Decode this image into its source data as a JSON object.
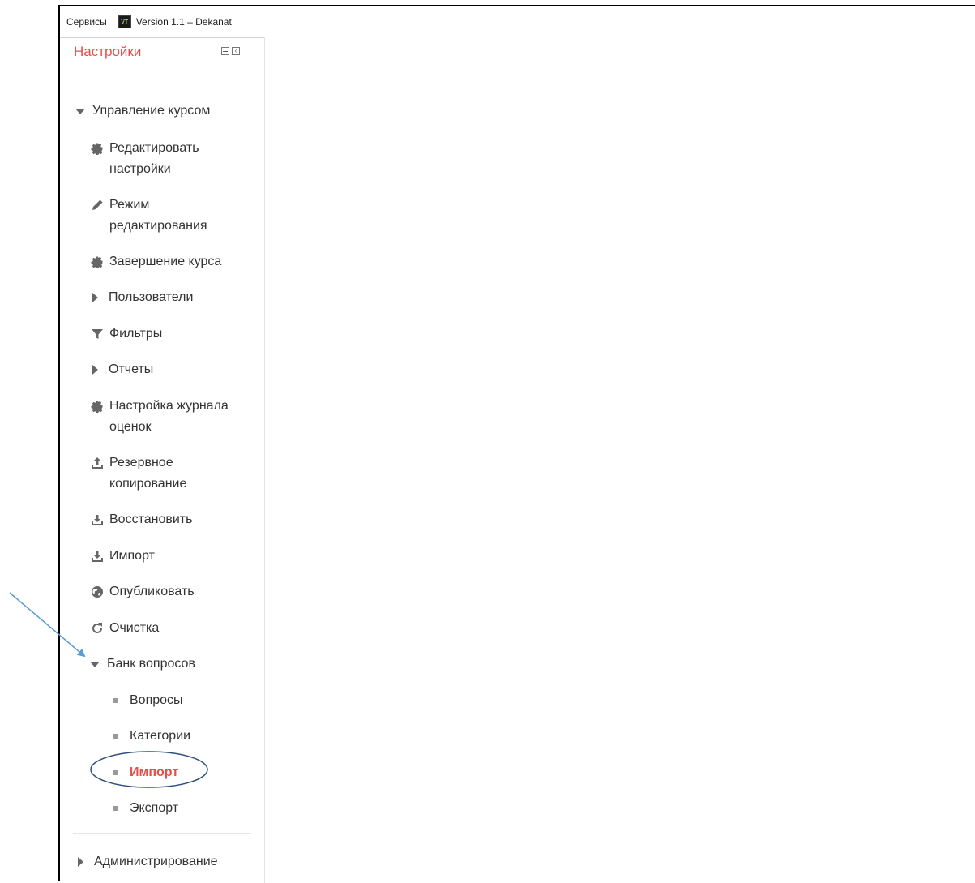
{
  "bookmarks": {
    "services": "Сервисы",
    "tab_icon_text": "VT",
    "tab_title": "Version 1.1 – Dekanat"
  },
  "block": {
    "title": "Настройки"
  },
  "menu": {
    "course_admin": "Управление курсом",
    "edit_settings": "Редактировать настройки",
    "edit_mode": "Режим редактирования",
    "course_completion": "Завершение курса",
    "users": "Пользователи",
    "filters": "Фильтры",
    "reports": "Отчеты",
    "gradebook_setup": "Настройка журнала оценок",
    "backup": "Резервное копирование",
    "restore": "Восстановить",
    "import": "Импорт",
    "publish": "Опубликовать",
    "reset": "Очистка",
    "question_bank": "Банк вопросов",
    "qb_questions": "Вопросы",
    "qb_categories": "Категории",
    "qb_import": "Импорт",
    "qb_export": "Экспорт",
    "site_admin": "Администрирование"
  },
  "colors": {
    "accent": "#e2514b",
    "annotation": "#5b9bd5",
    "annotation_ellipse": "#2f4f7f"
  }
}
